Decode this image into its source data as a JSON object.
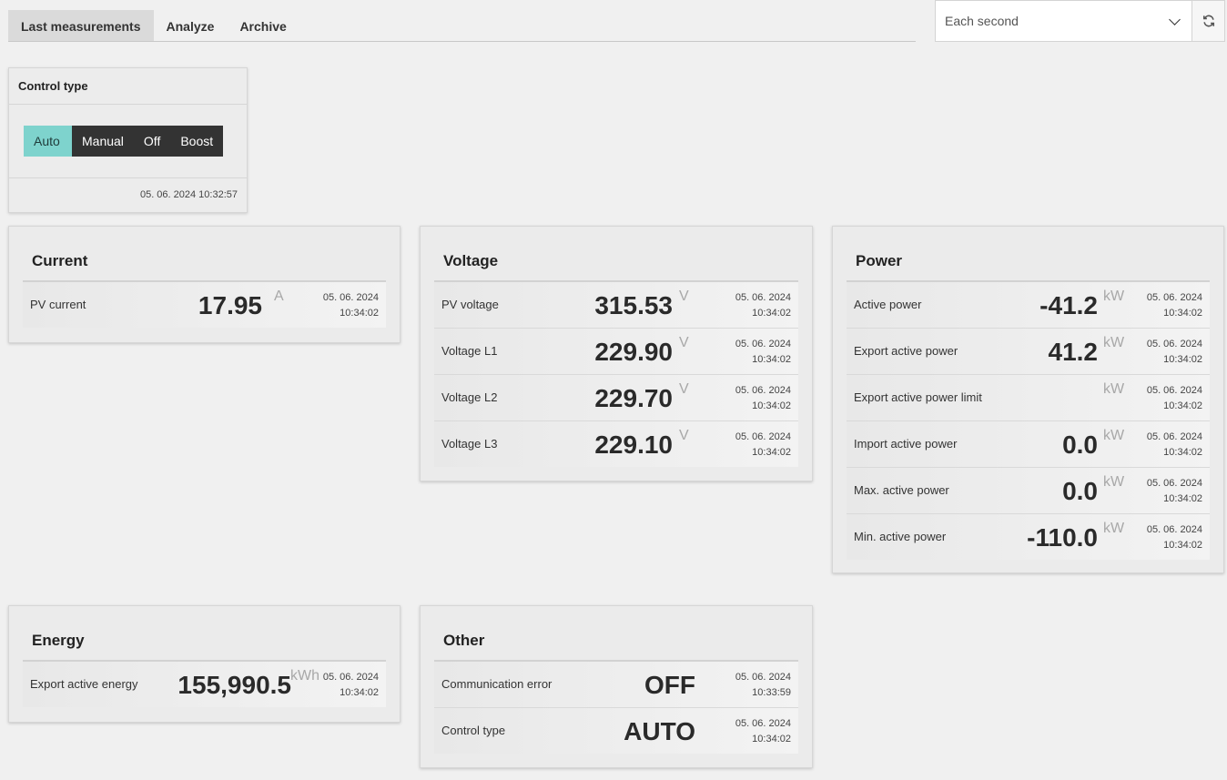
{
  "tabs": [
    "Last measurements",
    "Analyze",
    "Archive"
  ],
  "refresh": {
    "selected": "Each second"
  },
  "control": {
    "title": "Control type",
    "options": [
      "Auto",
      "Manual",
      "Off",
      "Boost"
    ],
    "selected": "Auto",
    "timestamp": "05. 06. 2024 10:32:57"
  },
  "cards": {
    "current": {
      "title": "Current",
      "rows": [
        {
          "label": "PV current",
          "value": "17.95",
          "unit": "A",
          "date": "05. 06. 2024",
          "time": "10:34:02"
        }
      ]
    },
    "voltage": {
      "title": "Voltage",
      "rows": [
        {
          "label": "PV voltage",
          "value": "315.53",
          "unit": "V",
          "date": "05. 06. 2024",
          "time": "10:34:02"
        },
        {
          "label": "Voltage L1",
          "value": "229.90",
          "unit": "V",
          "date": "05. 06. 2024",
          "time": "10:34:02"
        },
        {
          "label": "Voltage L2",
          "value": "229.70",
          "unit": "V",
          "date": "05. 06. 2024",
          "time": "10:34:02"
        },
        {
          "label": "Voltage L3",
          "value": "229.10",
          "unit": "V",
          "date": "05. 06. 2024",
          "time": "10:34:02"
        }
      ]
    },
    "power": {
      "title": "Power",
      "rows": [
        {
          "label": "Active power",
          "value": "-41.2",
          "unit": "kW",
          "date": "05. 06. 2024",
          "time": "10:34:02"
        },
        {
          "label": "Export active power",
          "value": "41.2",
          "unit": "kW",
          "date": "05. 06. 2024",
          "time": "10:34:02"
        },
        {
          "label": "Export active power limit",
          "value": "",
          "unit": "kW",
          "date": "05. 06. 2024",
          "time": "10:34:02"
        },
        {
          "label": "Import active power",
          "value": "0.0",
          "unit": "kW",
          "date": "05. 06. 2024",
          "time": "10:34:02"
        },
        {
          "label": "Max. active power",
          "value": "0.0",
          "unit": "kW",
          "date": "05. 06. 2024",
          "time": "10:34:02"
        },
        {
          "label": "Min. active power",
          "value": "-110.0",
          "unit": "kW",
          "date": "05. 06. 2024",
          "time": "10:34:02"
        }
      ]
    },
    "energy": {
      "title": "Energy",
      "rows": [
        {
          "label": "Export active energy",
          "value": "155,990.5",
          "unit": "kWh",
          "date": "05. 06. 2024",
          "time": "10:34:02"
        }
      ]
    },
    "other": {
      "title": "Other",
      "rows": [
        {
          "label": "Communication error",
          "value": "OFF",
          "unit": "",
          "date": "05. 06. 2024",
          "time": "10:33:59"
        },
        {
          "label": "Control type",
          "value": "AUTO",
          "unit": "",
          "date": "05. 06. 2024",
          "time": "10:34:02"
        }
      ]
    }
  },
  "colors": {
    "accent": "#7ed3cd",
    "dark": "#333333",
    "background": "#f0f0f0"
  }
}
